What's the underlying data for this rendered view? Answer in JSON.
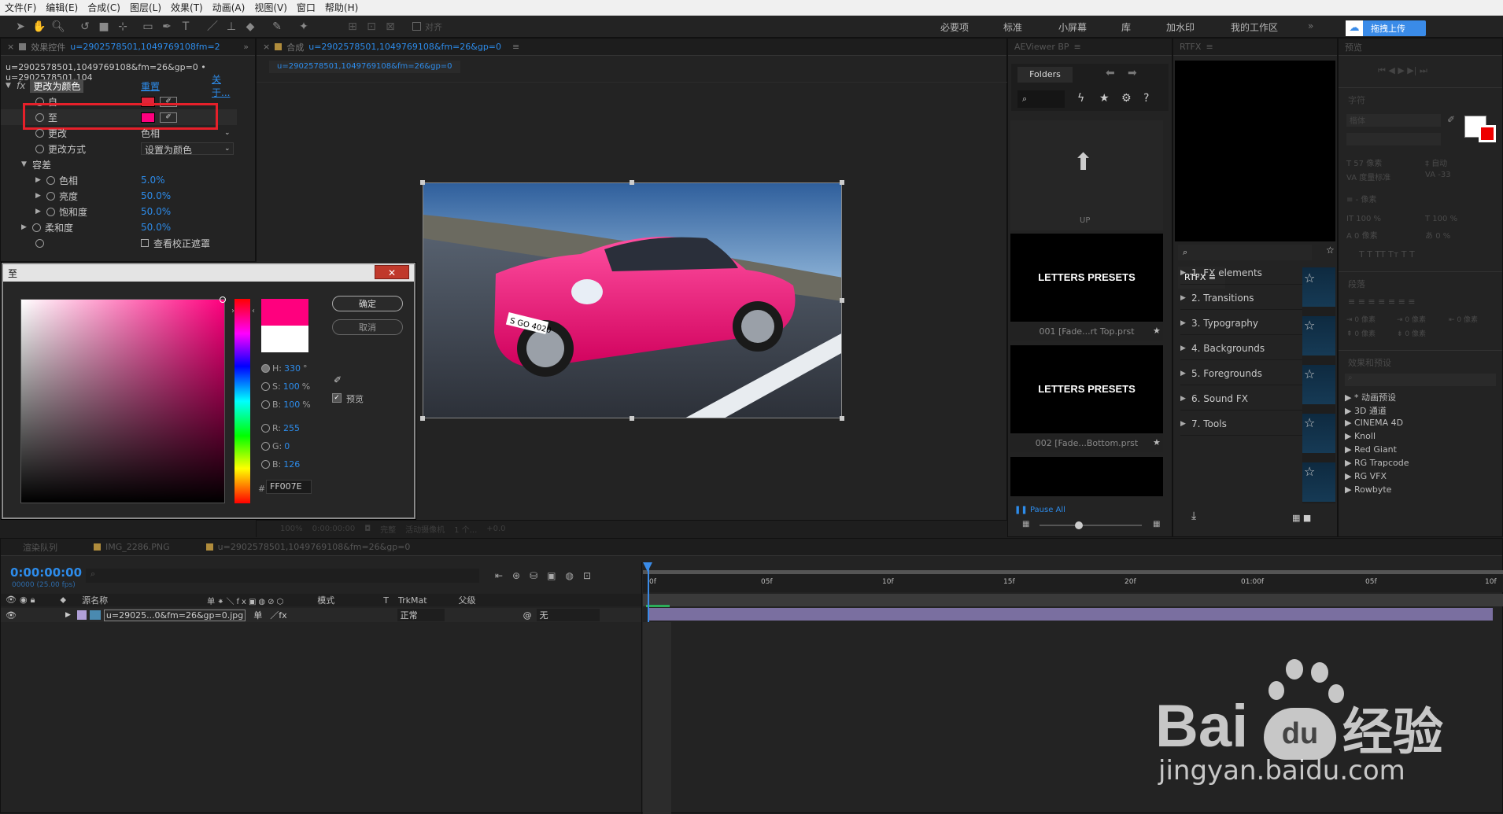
{
  "menu": [
    "文件(F)",
    "编辑(E)",
    "合成(C)",
    "图层(L)",
    "效果(T)",
    "动画(A)",
    "视图(V)",
    "窗口",
    "帮助(H)"
  ],
  "toolbar": {
    "align_label": "对齐",
    "workspaces": [
      "必要项",
      "标准",
      "小屏幕",
      "库",
      "加水印",
      "我的工作区"
    ],
    "upload_button": "拖拽上传"
  },
  "effects_panel": {
    "tab_label": "效果控件",
    "tab_file": "u=2902578501,1049769108fm=2",
    "path": "u=2902578501,1049769108&fm=26&gp=0 • u=2902578501,104",
    "effect_name": "更改为颜色",
    "reset": "重置",
    "about": "关于...",
    "props": [
      {
        "label": "自",
        "value": ""
      },
      {
        "label": "至",
        "value": ""
      },
      {
        "label": "更改",
        "value": "色相"
      },
      {
        "label": "更改方式",
        "value": "设置为颜色"
      },
      {
        "label": "容差",
        "value": ""
      },
      {
        "label": "色相",
        "value": "5.0%"
      },
      {
        "label": "亮度",
        "value": "50.0%"
      },
      {
        "label": "饱和度",
        "value": "50.0%"
      },
      {
        "label": "柔和度",
        "value": "50.0%"
      },
      {
        "label": "",
        "value": "查看校正遮罩"
      }
    ]
  },
  "comp_panel": {
    "tab_label": "合成",
    "tab_file": "u=2902578501,1049769108&fm=26&gp=0",
    "subtab": "u=2902578501,1049769108&fm=26&gp=0",
    "footer": {
      "zoom": "100%",
      "time": "0:00:00:00",
      "quality": "完整",
      "camera": "活动摄像机",
      "views": "1 个...",
      "exposure": "+0.0"
    }
  },
  "car_image": {
    "plate": "S GO 4020"
  },
  "color_dialog": {
    "title": "至",
    "ok": "确定",
    "cancel": "取消",
    "preview": "预览",
    "fields": [
      {
        "label": "H:",
        "value": "330",
        "unit": "°"
      },
      {
        "label": "S:",
        "value": "100",
        "unit": "%"
      },
      {
        "label": "B:",
        "value": "100",
        "unit": "%"
      },
      {
        "label": "R:",
        "value": "255",
        "unit": ""
      },
      {
        "label": "G:",
        "value": "0",
        "unit": ""
      },
      {
        "label": "B:",
        "value": "126",
        "unit": ""
      }
    ],
    "hex_prefix": "#",
    "hex": "FF007E"
  },
  "aeviewer": {
    "title": "AEViewer BP",
    "folders_label": "Folders",
    "up_label": "UP",
    "presets": [
      {
        "thumb": "LETTERS PRESETS",
        "name": "001 [Fade...rt Top.prst"
      },
      {
        "thumb": "LETTERS PRESETS",
        "name": "002 [Fade...Bottom.prst"
      }
    ],
    "pause": "Pause All"
  },
  "rtfx": {
    "title": "RTFX",
    "menu_label": "RTFX",
    "items": [
      "1. FX elements",
      "2. Transitions",
      "3. Typography",
      "4. Backgrounds",
      "5. Foregrounds",
      "6. Sound FX",
      "7. Tools"
    ]
  },
  "right_panel": {
    "preview": "预览",
    "character": "字符",
    "font": "楷体",
    "size": "57 像素",
    "auto": "自动",
    "tracking_label": "度量标准",
    "tracking": "-33",
    "px": "像素",
    "scale_v": "100 %",
    "scale_h": "100 %",
    "baseline": "0 像素",
    "tsume": "0 %",
    "paragraph": "段落",
    "indent": "0 像素",
    "effects_presets": "效果和预设",
    "plugins": [
      "* 动画预设",
      "3D 通道",
      "CINEMA 4D",
      "Knoll",
      "Red Giant",
      "RG Trapcode",
      "RG VFX",
      "Rowbyte"
    ]
  },
  "timeline": {
    "tabs": [
      "渲染队列",
      "IMG_2286.PNG",
      "u=2902578501,1049769108&fm=26&gp=0"
    ],
    "timecode": "0:00:00:00",
    "fps": "00000 (25.00 fps)",
    "headers": {
      "source": "源名称",
      "mode": "模式",
      "t": "T",
      "trkmat": "TrkMat",
      "parent": "父级"
    },
    "layer": {
      "name": "u=29025...0&fm=26&gp=0.jpg",
      "mode": "正常",
      "parent": "无"
    },
    "ruler": [
      "0f",
      "05f",
      "10f",
      "15f",
      "20f",
      "01:00f",
      "05f",
      "10f"
    ]
  },
  "watermark": {
    "logo": "Bai",
    "logo2": "du",
    "cn": "经验",
    "url": "jingyan.baidu.com"
  }
}
